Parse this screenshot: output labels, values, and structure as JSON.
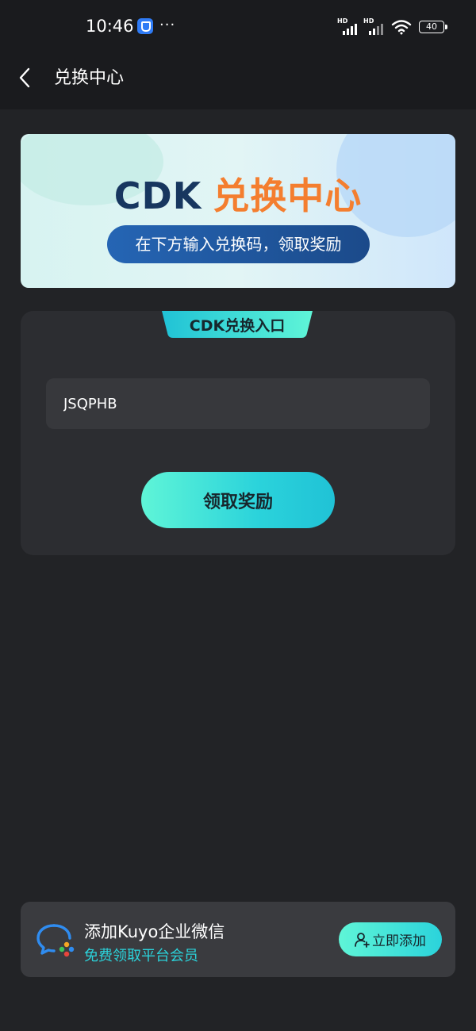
{
  "status_bar": {
    "time": "10:46",
    "more": "···",
    "signal1_label": "HD",
    "signal2_label": "HD",
    "battery": "40"
  },
  "header": {
    "title": "兑换中心"
  },
  "banner": {
    "title_prefix": "CDK",
    "title_main": "兑换中心",
    "subtitle": "在下方输入兑换码，领取奖励",
    "colors": {
      "prefix": "#17365f",
      "main": "#f47e2f",
      "pill": "#1f5aa4"
    }
  },
  "redeem": {
    "tab_label": "CDK兑换入口",
    "input_value": "JSQPHB",
    "claim_label": "领取奖励"
  },
  "promo": {
    "title": "添加Kuyo企业微信",
    "subtitle": "免费领取平台会员",
    "button_label": "立即添加",
    "accent_color": "#2bd3db"
  },
  "icons": {
    "back": "chevron-left-icon",
    "app": "app-notification-icon",
    "wifi": "wifi-icon",
    "battery": "battery-icon",
    "wechat": "wecom-icon",
    "add_user": "add-user-icon"
  }
}
